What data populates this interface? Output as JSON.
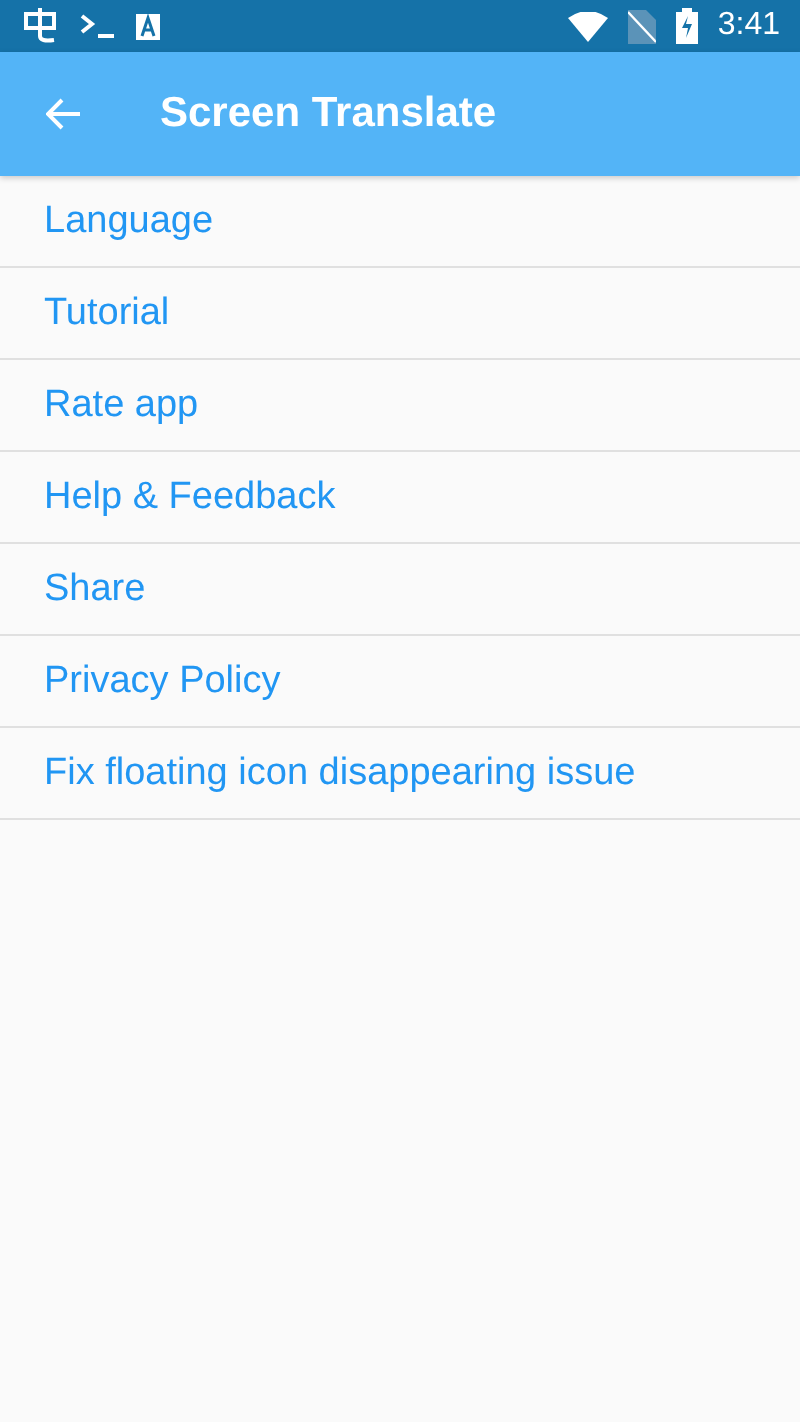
{
  "status_bar": {
    "time": "3:41"
  },
  "app_bar": {
    "title": "Screen Translate"
  },
  "menu": [
    {
      "label": "Language"
    },
    {
      "label": "Tutorial"
    },
    {
      "label": "Rate app"
    },
    {
      "label": "Help & Feedback"
    },
    {
      "label": "Share"
    },
    {
      "label": "Privacy Policy"
    },
    {
      "label": "Fix floating icon disappearing issue"
    }
  ]
}
